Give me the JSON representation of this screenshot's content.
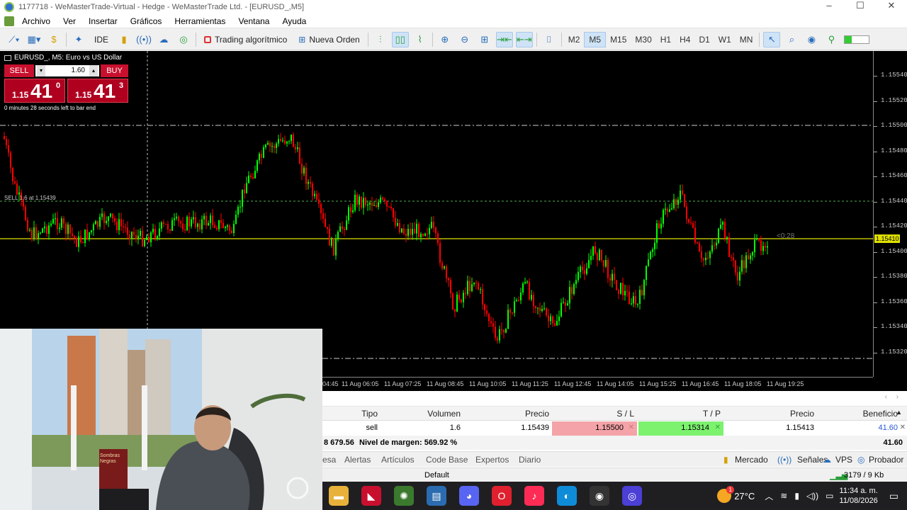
{
  "window": {
    "title": "1177718 - WeMasterTrade-Virtual - Hedge - WeMasterTrade Ltd. - [EURUSD_,M5]",
    "controls": [
      "–",
      "☐",
      "✕"
    ]
  },
  "menu": [
    "Archivo",
    "Ver",
    "Insertar",
    "Gráficos",
    "Herramientas",
    "Ventana",
    "Ayuda"
  ],
  "toolbar": {
    "ide_label": "IDE",
    "algo_label": "Trading algorítmico",
    "new_order_label": "Nueva Orden",
    "timeframes": [
      "M2",
      "M5",
      "M15",
      "M30",
      "H1",
      "H4",
      "D1",
      "W1",
      "MN"
    ],
    "active_timeframe": "M5"
  },
  "chart": {
    "symbol_header": "EURUSD_, M5:  Euro vs US Dollar",
    "sell_label": "SELL",
    "buy_label": "BUY",
    "lot": "1.60",
    "sell_price": {
      "small": "1.15",
      "big": "41",
      "sup": "0"
    },
    "buy_price": {
      "small": "1.15",
      "big": "41",
      "sup": "3"
    },
    "countdown": "0 minutes 28 seconds left to bar end",
    "position_label": "SELL 1.6  at 1.15439",
    "timer_label": "<0:28",
    "current_price_label": "1.15410",
    "price_axis": [
      "1.15540",
      "1.15520",
      "1.15500",
      "1.15480",
      "1.15460",
      "1.15440",
      "1.15420",
      "1.15400",
      "1.15380",
      "1.15360",
      "1.15340",
      "1.15320"
    ],
    "time_axis": [
      "04:45",
      "11 Aug 06:05",
      "11 Aug 07:25",
      "11 Aug 08:45",
      "11 Aug 10:05",
      "11 Aug 11:25",
      "11 Aug 12:45",
      "11 Aug 14:05",
      "11 Aug 15:25",
      "11 Aug 16:45",
      "11 Aug 18:05",
      "11 Aug 19:25"
    ],
    "colors": {
      "bull": "#00ff00",
      "bear": "#ff0000",
      "bid": "#e0e000",
      "background": "#000000"
    }
  },
  "trade_table": {
    "headers": [
      "Tipo",
      "Volumen",
      "Precio",
      "S / L",
      "T / P",
      "Precio",
      "Beneficio"
    ],
    "row": {
      "tipo": "sell",
      "volumen": "1.6",
      "precio_apertura": "1.15439",
      "sl": "1.15500",
      "tp": "1.15314",
      "precio_actual": "1.15413",
      "beneficio": "41.60"
    },
    "summary_balance": "8 679.56",
    "summary_margin": "Nivel de margen: 569.92 %",
    "summary_profit": "41.60"
  },
  "bottom_tabs": [
    "esa",
    "Alertas",
    "Artículos",
    "Code Base",
    "Expertos",
    "Diario"
  ],
  "bottom_right": [
    "Mercado",
    "Señales",
    "VPS",
    "Probador"
  ],
  "status": {
    "profile": "Default",
    "traffic": "3179 / 9 Kb"
  },
  "taskbar": {
    "temperature": "27°C",
    "time": "11:34 a. m.",
    "date": "11/08/2026",
    "weather_badge": "1"
  },
  "webcam": {
    "book_title": "Sombras Negras"
  }
}
